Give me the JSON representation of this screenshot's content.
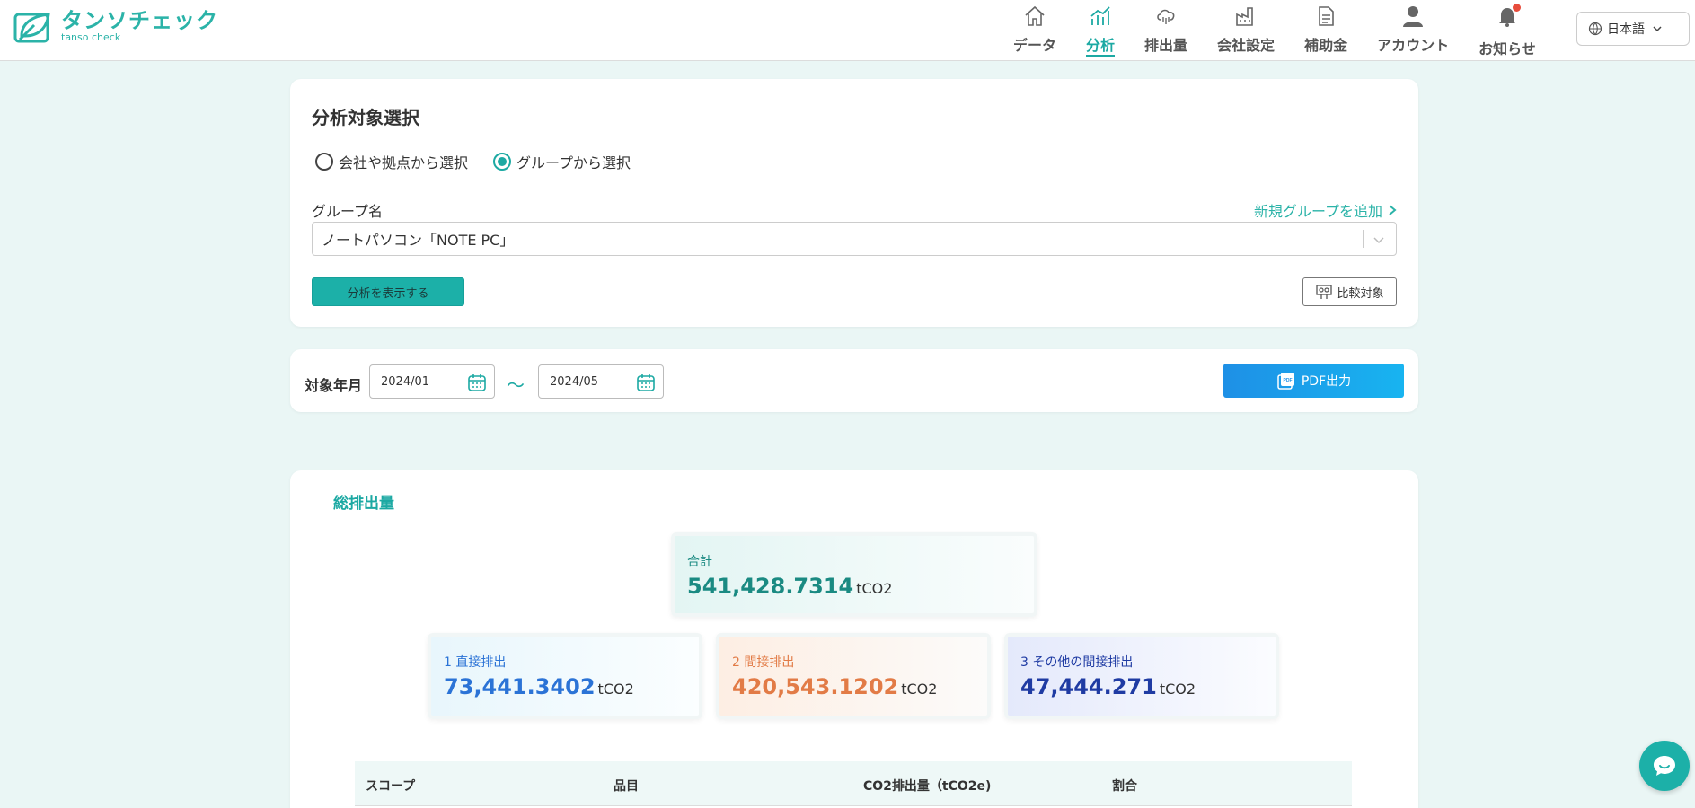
{
  "brand": {
    "name": "タンソチェック",
    "sub": "tanso check"
  },
  "nav": [
    {
      "label": "データ",
      "icon": "home-icon",
      "active": false
    },
    {
      "label": "分析",
      "icon": "chart-icon",
      "active": true
    },
    {
      "label": "排出量",
      "icon": "cloud-icon",
      "active": false
    },
    {
      "label": "会社設定",
      "icon": "factory-icon",
      "active": false
    },
    {
      "label": "補助金",
      "icon": "document-icon",
      "active": false
    },
    {
      "label": "アカウント",
      "icon": "user-icon",
      "active": false
    },
    {
      "label": "お知らせ",
      "icon": "bell-icon",
      "active": false
    }
  ],
  "lang": {
    "label": "日本語"
  },
  "selection": {
    "title": "分析対象選択",
    "radio1": "会社や拠点から選択",
    "radio2": "グループから選択",
    "group_label": "グループ名",
    "add_group": "新規グループを追加",
    "group_value": "ノートパソコン「NOTE PC」",
    "show_button": "分析を表示する",
    "compare_button": "比較対象"
  },
  "period": {
    "label": "対象年月",
    "from": "2024/01",
    "sep": "〜",
    "to": "2024/05",
    "pdf_button": "PDF出力"
  },
  "totals": {
    "title": "総排出量",
    "total_label": "合計",
    "total_value": "541,428.7314",
    "unit": "tCO2",
    "s1_label": "1 直接排出",
    "s1_value": "73,441.3402",
    "s2_label": "2 間接排出",
    "s2_value": "420,543.1202",
    "s3_label": "3 その他の間接排出",
    "s3_value": "47,444.271"
  },
  "table": {
    "headers": [
      "スコープ",
      "品目",
      "CO2排出量（tCO2e)",
      "割合"
    ]
  },
  "colors": {
    "accent": "#1ca9a3",
    "pdf": "#1e90e6",
    "scope1": "#2b73d6",
    "scope2": "#e27b46",
    "scope3": "#1f3ba3"
  }
}
